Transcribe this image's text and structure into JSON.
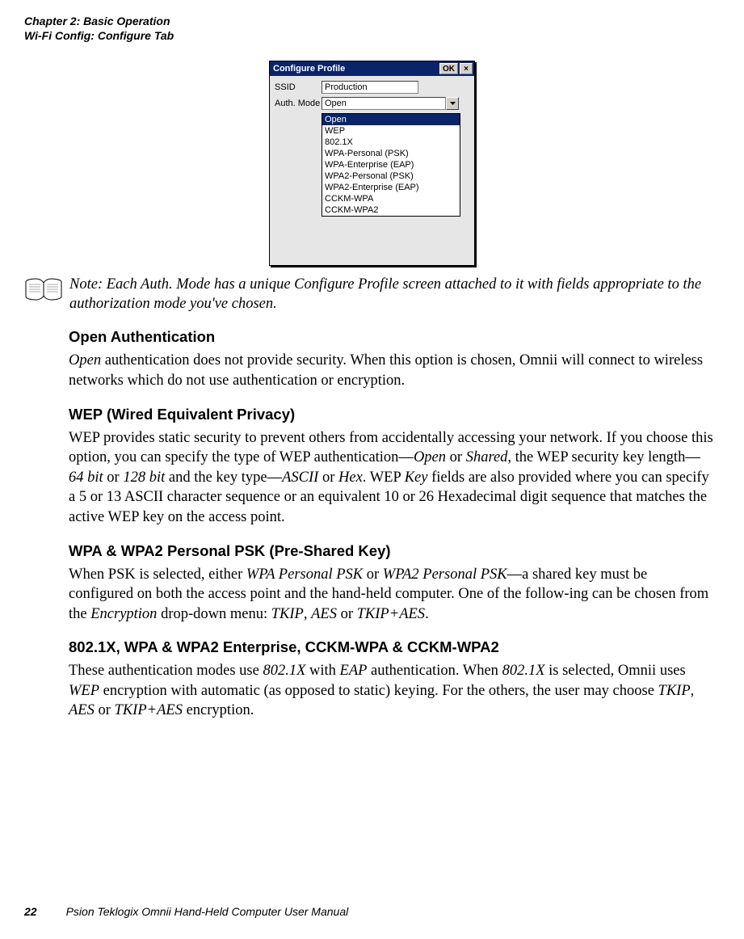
{
  "running_head": {
    "line1": "Chapter 2:  Basic Operation",
    "line2": "Wi-Fi Config: Configure Tab"
  },
  "win": {
    "title": "Configure Profile",
    "ok_label": "OK",
    "close_glyph": "×",
    "ssid_label": "SSID",
    "ssid_value": "Production",
    "auth_label": "Auth. Mode",
    "auth_value": "Open",
    "auth_options": [
      "Open",
      "WEP",
      "802.1X",
      "WPA-Personal (PSK)",
      "WPA-Enterprise (EAP)",
      "WPA2-Personal (PSK)",
      "WPA2-Enterprise (EAP)",
      "CCKM-WPA",
      "CCKM-WPA2"
    ]
  },
  "note": {
    "label": "Note:",
    "text": "Each Auth. Mode has a unique Configure Profile screen attached to it with fields appropriate to the authorization mode you've chosen."
  },
  "sections": {
    "open": {
      "head": "Open Authentication",
      "p1a": "Open",
      "p1b": " authentication does not provide security. When this option is chosen, Omnii will connect to wireless networks which do not use authentication or encryption."
    },
    "wep": {
      "head": "WEP (Wired Equivalent Privacy)",
      "p1a": "WEP provides static security to prevent others from accidentally accessing your network. If you choose this option, you can specify the type of WEP authentication—",
      "p1b": "Open",
      "p1c": " or ",
      "p1d": "Shared",
      "p1e": ", the WEP security key length—",
      "p1f": "64 bit",
      "p1g": " or ",
      "p1h": "128 bit",
      "p1i": " and the key type—",
      "p1j": "ASCII",
      "p1k": " or ",
      "p1l": "Hex",
      "p1m": ". WEP ",
      "p1n": "Key",
      "p1o": " fields are also provided where you can specify a 5 or 13 ASCII character sequence or an equivalent 10 or 26 Hexadecimal digit sequence that matches the active WEP key on the access point."
    },
    "psk": {
      "head": "WPA & WPA2 Personal PSK (Pre-Shared Key)",
      "p1a": "When PSK is selected, either ",
      "p1b": "WPA Personal PSK",
      "p1c": " or ",
      "p1d": "WPA2 Personal PSK",
      "p1e": "—a shared key must be configured on both the access point and the hand-held computer. One of the follow-ing can be chosen from the ",
      "p1f": "Encryption",
      "p1g": " drop-down menu: ",
      "p1h": "TKIP",
      "p1i": ", ",
      "p1j": "AES",
      "p1k": " or ",
      "p1l": "TKIP+AES",
      "p1m": "."
    },
    "ent": {
      "head": "802.1X, WPA & WPA2 Enterprise, CCKM-WPA & CCKM-WPA2",
      "p1a": "These authentication modes use ",
      "p1b": "802.1X",
      "p1c": " with ",
      "p1d": "EAP",
      "p1e": " authentication. When ",
      "p1f": "802.1X",
      "p1g": " is selected, Omnii uses ",
      "p1h": "WEP",
      "p1i": " encryption with automatic (as opposed to static) keying. For the others, the user may choose ",
      "p1j": "TKIP",
      "p1k": ", ",
      "p1l": "AES",
      "p1m": " or ",
      "p1n": "TKIP+AES",
      "p1o": " encryption."
    }
  },
  "footer": {
    "page_number": "22",
    "title": "Psion Teklogix Omnii Hand-Held Computer User Manual"
  }
}
